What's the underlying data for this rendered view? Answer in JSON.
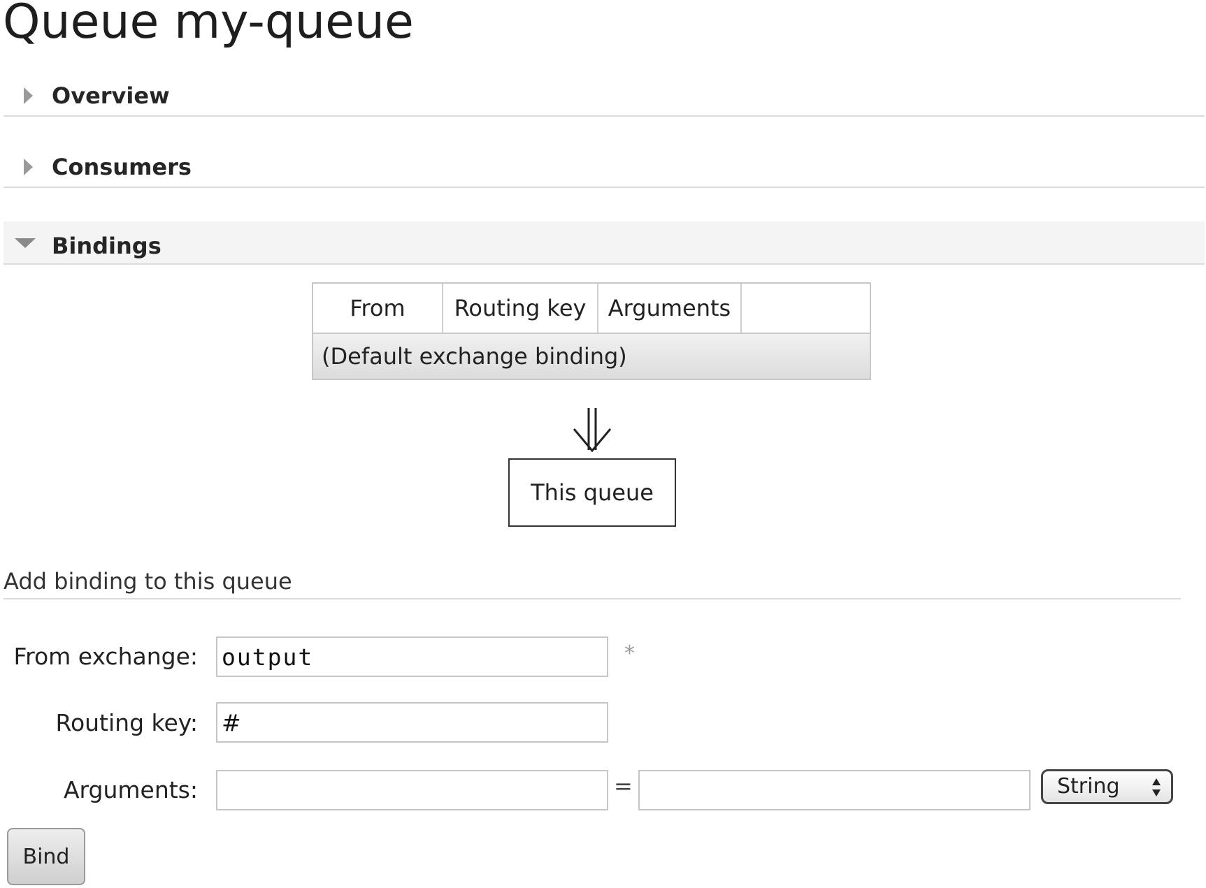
{
  "page": {
    "title": "Queue my-queue"
  },
  "sections": {
    "overview": "Overview",
    "consumers": "Consumers",
    "bindings": "Bindings"
  },
  "bindings_table": {
    "headers": [
      "From",
      "Routing key",
      "Arguments",
      ""
    ],
    "rows": [
      {
        "text": "(Default exchange binding)"
      }
    ]
  },
  "diagram": {
    "arrow_icon": "double-down-arrow-icon",
    "target": "This queue"
  },
  "add_binding": {
    "heading": "Add binding to this queue",
    "from_exchange": {
      "label": "From exchange:",
      "value": "output",
      "required_marker": "*"
    },
    "routing_key": {
      "label": "Routing key:",
      "value": "#"
    },
    "arguments": {
      "label": "Arguments:",
      "key_value": "",
      "equals": "=",
      "value_value": "",
      "type_selected": "String",
      "type_icon": "updown-arrows-icon"
    },
    "submit_label": "Bind"
  },
  "colors": {
    "text": "#222222",
    "divider": "#dcdcdc",
    "open_section_bg": "#f4f4f4",
    "asterisk": "#9a9a9a"
  }
}
